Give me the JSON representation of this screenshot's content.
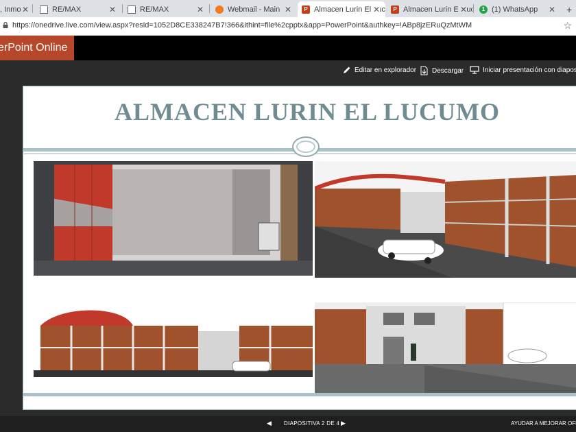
{
  "browser": {
    "tabs": [
      {
        "label": ", Inmo",
        "icon": "page-icon",
        "active": false
      },
      {
        "label": "RE/MAX",
        "icon": "page-icon",
        "active": false
      },
      {
        "label": "RE/MAX",
        "icon": "page-icon",
        "active": false
      },
      {
        "label": "Webmail - Main",
        "icon": "webmail-icon",
        "active": false
      },
      {
        "label": "Almacen Lurin El Luc",
        "icon": "powerpoint-icon",
        "active": true
      },
      {
        "label": "Almacen Lurin El Luc",
        "icon": "powerpoint-icon",
        "active": false
      },
      {
        "label": "(1) WhatsApp",
        "icon": "whatsapp-icon",
        "active": false
      }
    ],
    "new_tab": "+",
    "url": "https://onedrive.live.com/view.aspx?resid=1052D8CE338247B7!366&ithint=file%2cpptx&app=PowerPoint&authkey=!ABp8jzERuQzMtWM",
    "whatsapp_badge": "1"
  },
  "app": {
    "name": "erPoint Online",
    "brand_color": "#b7472a"
  },
  "commands": {
    "edit": "Editar en explorador",
    "download": "Descargar",
    "present": "Iniciar presentación con diapositivas"
  },
  "slide": {
    "title": "ALMACEN LURIN EL LUCUMO",
    "title_color": "#6f8c92",
    "images": [
      "warehouse-top-view",
      "warehouse-street-view",
      "warehouse-front-elevation",
      "warehouse-courtyard-view"
    ]
  },
  "statusbar": {
    "prev": "◀",
    "page": "DIAPOSITIVA 2 DE 4",
    "next": "▶",
    "help": "AYUDAR A MEJORAR OFFICE"
  }
}
